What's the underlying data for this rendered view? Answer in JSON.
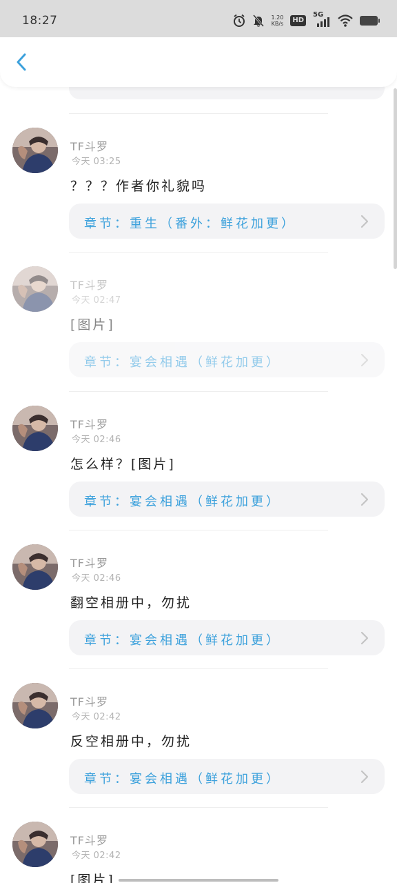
{
  "status_bar": {
    "time": "18:27",
    "net_rate_top": "1.20",
    "net_rate_bottom": "KB/s",
    "hd": "HD",
    "network": "5G",
    "icons": [
      "alarm-icon",
      "mute-icon",
      "hd-icon",
      "signal-icon",
      "wifi-icon",
      "battery-icon"
    ]
  },
  "header": {
    "back_icon": "chevron-left-icon",
    "accent_color": "#3ca1dc"
  },
  "comments": [
    {
      "username": "TF斗罗",
      "time": "今天 03:25",
      "content": "？？？作者你礼貌吗",
      "chapter": "章节：重生（番外：鲜花加更）",
      "faded": false
    },
    {
      "username": "TF斗罗",
      "time": "今天 02:47",
      "content": "[图片]",
      "chapter": "章节：宴会相遇（鲜花加更）",
      "faded": true
    },
    {
      "username": "TF斗罗",
      "time": "今天 02:46",
      "content": "怎么样？[图片]",
      "chapter": "章节：宴会相遇（鲜花加更）",
      "faded": false
    },
    {
      "username": "TF斗罗",
      "time": "今天 02:46",
      "content": "翻空相册中，勿扰",
      "chapter": "章节：宴会相遇（鲜花加更）",
      "faded": false
    },
    {
      "username": "TF斗罗",
      "time": "今天 02:42",
      "content": "反空相册中，勿扰",
      "chapter": "章节：宴会相遇（鲜花加更）",
      "faded": false
    },
    {
      "username": "TF斗罗",
      "time": "今天 02:42",
      "content": "[图片]",
      "chapter": "",
      "faded": false
    }
  ],
  "colors": {
    "chapter_text": "#3ca1dc",
    "card_bg": "#f3f3f5",
    "status_bar_bg": "#dcdcdc"
  }
}
